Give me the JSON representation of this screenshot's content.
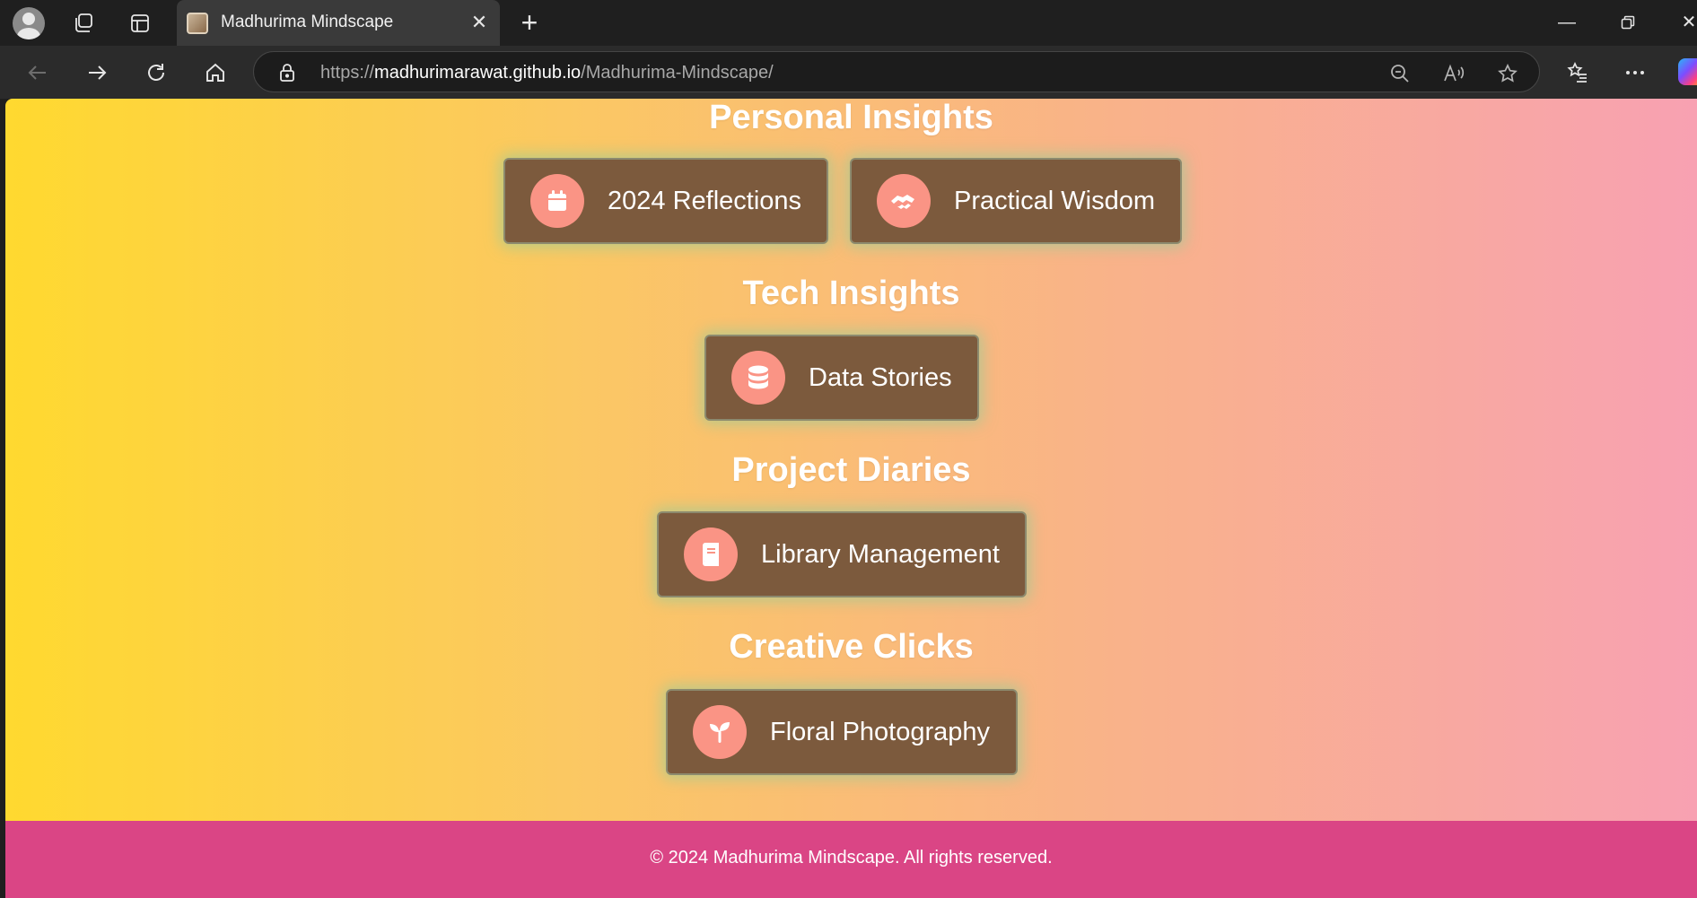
{
  "browser": {
    "tab_title": "Madhurima Mindscape",
    "url_scheme": "https://",
    "url_host": "madhurimarawat.github.io",
    "url_path": "/Madhurima-Mindscape/"
  },
  "sections": [
    {
      "title": "Personal Insights",
      "cards": [
        {
          "label": "2024 Reflections",
          "icon": "calendar-icon"
        },
        {
          "label": "Practical Wisdom",
          "icon": "handshake-icon"
        }
      ]
    },
    {
      "title": "Tech Insights",
      "cards": [
        {
          "label": "Data Stories",
          "icon": "database-icon"
        }
      ]
    },
    {
      "title": "Project Diaries",
      "cards": [
        {
          "label": "Library Management",
          "icon": "book-icon"
        }
      ]
    },
    {
      "title": "Creative Clicks",
      "cards": [
        {
          "label": "Floral Photography",
          "icon": "seedling-icon"
        }
      ]
    }
  ],
  "footer": {
    "text": "© 2024 Madhurima Mindscape. All rights reserved."
  },
  "colors": {
    "card_bg": "#7c5a3d",
    "icon_circle": "#fa9485",
    "footer_bg": "#da4585",
    "gradient_start": "#ffd92f",
    "gradient_end": "#f8a1b2"
  }
}
